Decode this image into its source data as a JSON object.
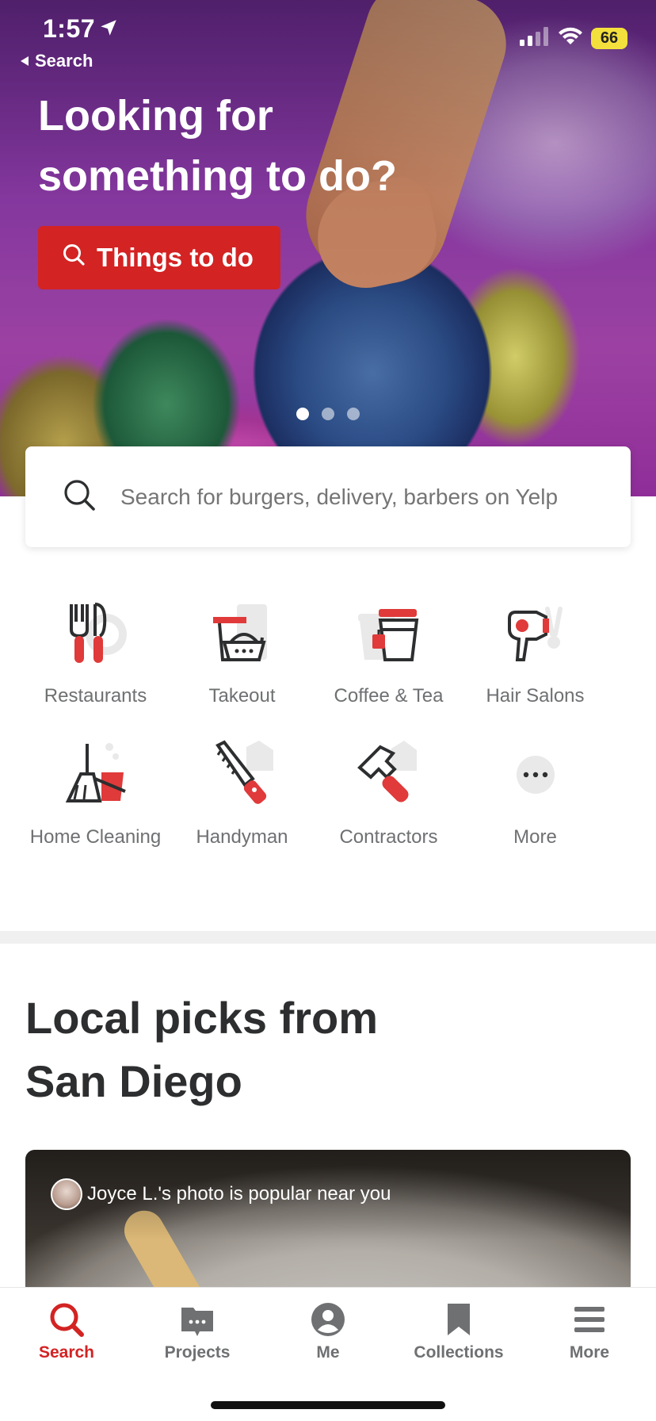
{
  "status_bar": {
    "time": "1:57",
    "back_label": "Search",
    "battery": "66"
  },
  "hero": {
    "title": "Looking for something to do?",
    "button_label": "Things to do",
    "slides_total": 3,
    "active_slide": 1
  },
  "search": {
    "placeholder": "Search for burgers, delivery, barbers on Yelp"
  },
  "categories": [
    {
      "label": "Restaurants",
      "icon": "fork-knife-icon"
    },
    {
      "label": "Takeout",
      "icon": "takeout-bag-icon"
    },
    {
      "label": "Coffee & Tea",
      "icon": "coffee-cup-icon"
    },
    {
      "label": "Hair Salons",
      "icon": "hair-dryer-icon"
    },
    {
      "label": "Home Cleaning",
      "icon": "broom-icon"
    },
    {
      "label": "Handyman",
      "icon": "saw-icon"
    },
    {
      "label": "Contractors",
      "icon": "hammer-icon"
    },
    {
      "label": "More",
      "icon": "more-dots-icon"
    }
  ],
  "local_picks": {
    "title": "Local picks from San Diego",
    "card_caption": "Joyce L.'s photo is popular near you"
  },
  "tab_bar": {
    "tabs": [
      {
        "label": "Search",
        "icon": "search-icon",
        "active": true
      },
      {
        "label": "Projects",
        "icon": "projects-folder-icon",
        "active": false
      },
      {
        "label": "Me",
        "icon": "profile-icon",
        "active": false
      },
      {
        "label": "Collections",
        "icon": "bookmark-icon",
        "active": false
      },
      {
        "label": "More",
        "icon": "menu-icon",
        "active": false
      }
    ]
  },
  "colors": {
    "brand_red": "#d32323",
    "icon_dark": "#2d2e2f",
    "icon_gray": "#e6e6e6",
    "text_gray": "#6e7072"
  }
}
